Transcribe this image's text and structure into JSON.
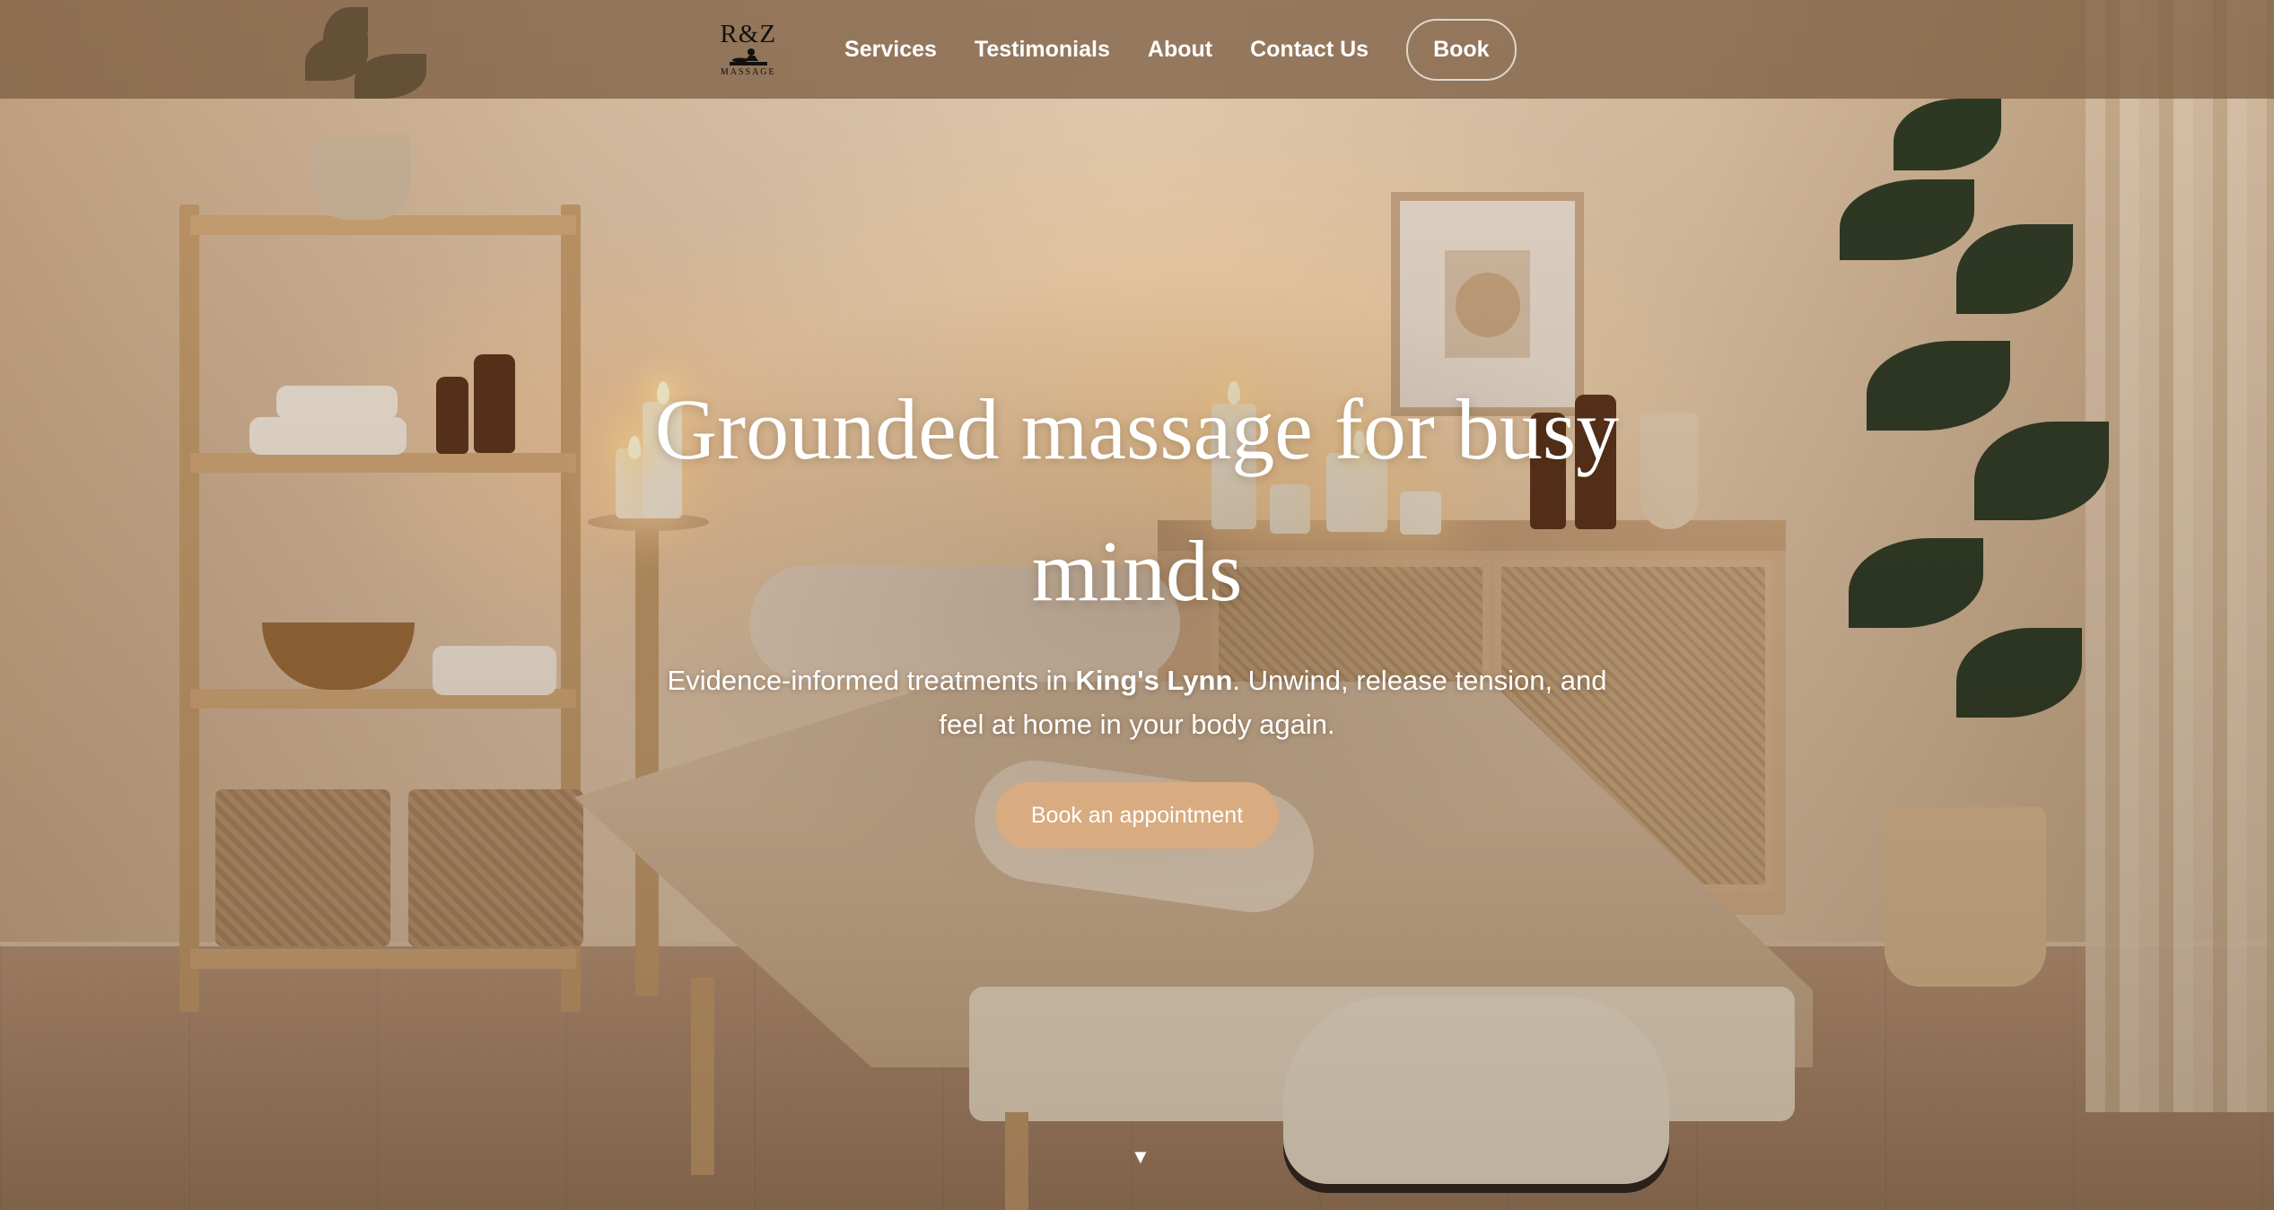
{
  "brand": {
    "logo_text": "R&Z",
    "logo_sub": "MASSAGE",
    "logo_icon": "massage-figure-icon"
  },
  "nav": {
    "items": [
      {
        "label": "Services"
      },
      {
        "label": "Testimonials"
      },
      {
        "label": "About"
      },
      {
        "label": "Contact Us"
      }
    ],
    "book_label": "Book"
  },
  "hero": {
    "title": "Grounded massage for busy minds",
    "subtitle_pre": "Evidence-informed treatments in ",
    "subtitle_bold": "King's Lynn",
    "subtitle_post": ". Unwind, release tension, and feel at home in your body again.",
    "cta_label": "Book an appointment",
    "scroll_icon": "down-triangle-icon",
    "scroll_glyph": "▼"
  },
  "colors": {
    "header_bg": "#785a3e",
    "cta_bg": "#d8ab80",
    "text": "#ffffff"
  }
}
